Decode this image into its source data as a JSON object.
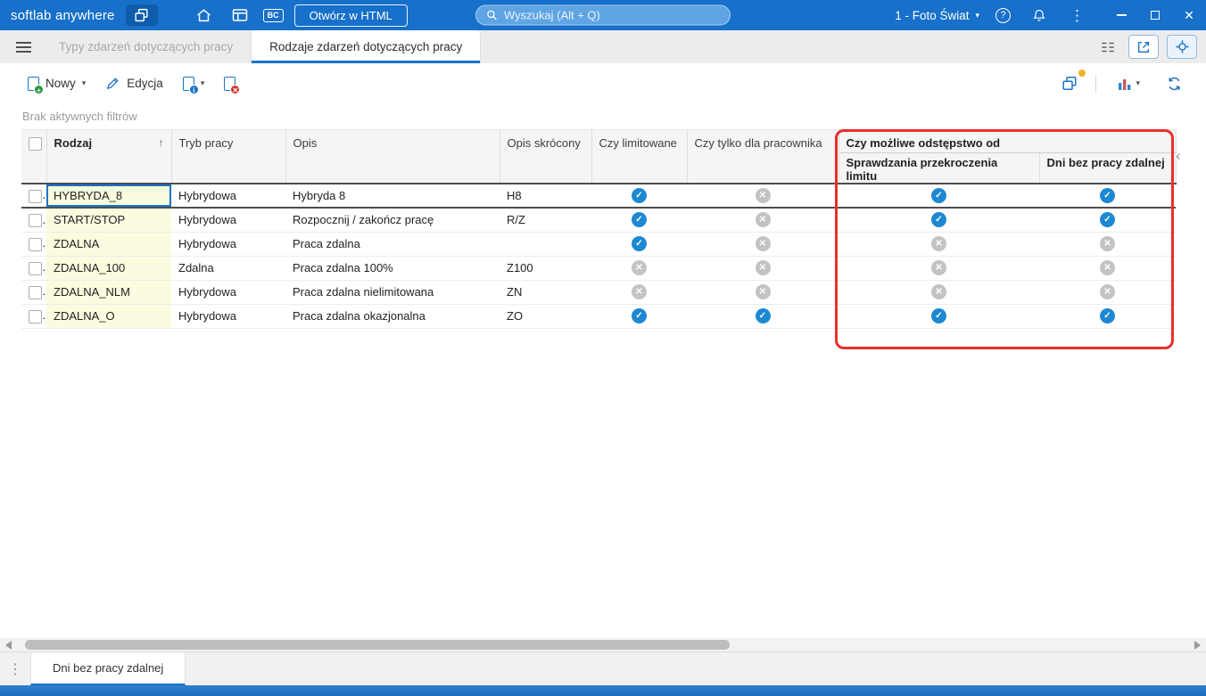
{
  "titlebar": {
    "app_name": "softlab anywhere",
    "bc_label": "BC",
    "open_html_label": "Otwórz w HTML",
    "search_placeholder": "Wyszukaj (Alt + Q)",
    "company": "1 - Foto Świat"
  },
  "tabbar": {
    "tabs": [
      {
        "label": "Typy zdarzeń dotyczących pracy"
      },
      {
        "label": "Rodzaje zdarzeń dotyczących pracy"
      }
    ]
  },
  "toolbar": {
    "new_label": "Nowy",
    "edit_label": "Edycja"
  },
  "filterbar": {
    "status": "Brak aktywnych filtrów"
  },
  "table": {
    "columns": {
      "rodzaj": "Rodzaj",
      "tryb": "Tryb pracy",
      "opis": "Opis",
      "opis_skrocony": "Opis skrócony",
      "czy_limitowane": "Czy limitowane",
      "czy_tylko": "Czy tylko dla pracownika"
    },
    "group": {
      "label": "Czy możliwe odstępstwo od",
      "sub1": "Sprawdzania przekroczenia limitu",
      "sub2": "Dni bez pracy zdalnej"
    },
    "rows": [
      {
        "rodzaj": "HYBRYDA_8",
        "tryb": "Hybrydowa",
        "opis": "Hybryda 8",
        "opis_skrocony": "H8",
        "czy_limitowane": true,
        "czy_tylko": false,
        "odstepstwo_limit": true,
        "odstepstwo_dni": true,
        "selected": true
      },
      {
        "rodzaj": "START/STOP",
        "tryb": "Hybrydowa",
        "opis": "Rozpocznij / zakończ pracę",
        "opis_skrocony": "R/Z",
        "czy_limitowane": true,
        "czy_tylko": false,
        "odstepstwo_limit": true,
        "odstepstwo_dni": true,
        "selected": false
      },
      {
        "rodzaj": "ZDALNA",
        "tryb": "Hybrydowa",
        "opis": "Praca zdalna",
        "opis_skrocony": "",
        "czy_limitowane": true,
        "czy_tylko": false,
        "odstepstwo_limit": false,
        "odstepstwo_dni": false,
        "selected": false
      },
      {
        "rodzaj": "ZDALNA_100",
        "tryb": "Zdalna",
        "opis": "Praca zdalna 100%",
        "opis_skrocony": "Z100",
        "czy_limitowane": false,
        "czy_tylko": false,
        "odstepstwo_limit": false,
        "odstepstwo_dni": false,
        "selected": false
      },
      {
        "rodzaj": "ZDALNA_NLM",
        "tryb": "Hybrydowa",
        "opis": "Praca zdalna nielimitowana",
        "opis_skrocony": "ZN",
        "czy_limitowane": false,
        "czy_tylko": false,
        "odstepstwo_limit": false,
        "odstepstwo_dni": false,
        "selected": false
      },
      {
        "rodzaj": "ZDALNA_O",
        "tryb": "Hybrydowa",
        "opis": "Praca zdalna okazjonalna",
        "opis_skrocony": "ZO",
        "czy_limitowane": true,
        "czy_tylko": true,
        "odstepstwo_limit": true,
        "odstepstwo_dni": true,
        "selected": false
      }
    ]
  },
  "bottombar": {
    "tab_label": "Dni bez pracy zdalnej"
  },
  "colors": {
    "titlebar_bg": "#1770c9",
    "accent": "#1a73c8",
    "check_on": "#1e88d2",
    "check_off": "#c3c3c3",
    "annotation": "#e8302e",
    "key_cell_bg": "#fbfbdf"
  },
  "icons": {
    "layers-icon": "stacked-squares",
    "home-icon": "house",
    "news-panel-icon": "panel-with-lines",
    "search-icon": "magnifier",
    "help-icon": "? in circle",
    "bell-icon": "bell",
    "kebab-icon": "⋮",
    "minimize-icon": "–",
    "maximize-icon": "□",
    "close-icon": "✕",
    "menu-icon": "☰",
    "new-doc-icon": "document + green plus",
    "edit-pencil-icon": "pencil",
    "doc-info-icon": "document + i",
    "doc-delete-icon": "document + red x",
    "chart-icon": "bar chart",
    "refresh-icon": "circular arrows",
    "tree-icon": "hierarchy lines",
    "share-icon": "arrow out of box",
    "locate-icon": "crosshair",
    "sort-asc-icon": "↑",
    "check-circle-icon": "✓ in blue circle",
    "cross-circle-icon": "✕ in gray circle",
    "collapse-icon": "‹"
  }
}
